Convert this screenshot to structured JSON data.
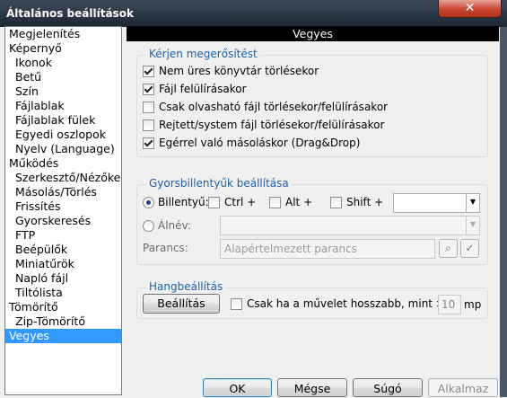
{
  "window": {
    "title": "Általános beállítások",
    "close_glyph": "✕"
  },
  "tree": {
    "items": [
      {
        "label": "Megjelenítés",
        "level": 0,
        "selected": false
      },
      {
        "label": "Képernyő",
        "level": 0,
        "selected": false
      },
      {
        "label": "Ikonok",
        "level": 1,
        "selected": false
      },
      {
        "label": "Betű",
        "level": 1,
        "selected": false
      },
      {
        "label": "Szín",
        "level": 1,
        "selected": false
      },
      {
        "label": "Fájlablak",
        "level": 1,
        "selected": false
      },
      {
        "label": "Fájlablak fülek",
        "level": 1,
        "selected": false
      },
      {
        "label": "Egyedi oszlopok",
        "level": 1,
        "selected": false
      },
      {
        "label": "Nyelv (Language)",
        "level": 1,
        "selected": false
      },
      {
        "label": "Működés",
        "level": 0,
        "selected": false
      },
      {
        "label": "Szerkesztő/Nézőke",
        "level": 1,
        "selected": false
      },
      {
        "label": "Másolás/Törlés",
        "level": 1,
        "selected": false
      },
      {
        "label": "Frissítés",
        "level": 1,
        "selected": false
      },
      {
        "label": "Gyorskeresés",
        "level": 1,
        "selected": false
      },
      {
        "label": "FTP",
        "level": 1,
        "selected": false
      },
      {
        "label": "Beépülők",
        "level": 1,
        "selected": false
      },
      {
        "label": "Miniatűrök",
        "level": 1,
        "selected": false
      },
      {
        "label": "Napló fájl",
        "level": 1,
        "selected": false
      },
      {
        "label": "Tiltólista",
        "level": 1,
        "selected": false
      },
      {
        "label": "Tömörítő",
        "level": 0,
        "selected": false
      },
      {
        "label": "Zip-Tömörítő",
        "level": 1,
        "selected": false
      },
      {
        "label": "Vegyes",
        "level": 0,
        "selected": true
      }
    ]
  },
  "panel": {
    "header": "Vegyes",
    "confirm_group": {
      "title": "Kérjen megerősítést",
      "options": [
        {
          "label": "Nem üres könyvtár törlésekor",
          "checked": true
        },
        {
          "label": "Fájl felülírásakor",
          "checked": true
        },
        {
          "label": "Csak olvasható fájl törlésekor/felülírásakor",
          "checked": false
        },
        {
          "label": "Rejtett/system fájl törlésekor/felülírásakor",
          "checked": false
        },
        {
          "label": "Egérrel való másoláskor (Drag&Drop)",
          "checked": true
        }
      ]
    },
    "hotkey_group": {
      "title": "Gyorsbillentyűk beállítása",
      "radio_key_label": "Billentyű:",
      "ctrl_label": "Ctrl +",
      "alt_label": "Alt +",
      "shift_label": "Shift +",
      "key_combo_value": "",
      "radio_alias_label": "Álnév:",
      "alias_value": "",
      "command_label": "Parancs:",
      "command_placeholder": "Alapértelmezett parancs",
      "combo_arrow_glyph": "▼",
      "search_glyph": "⌕",
      "check_glyph": "✓"
    },
    "sound_group": {
      "title": "Hangbeállítás",
      "settings_button": "Beállítás",
      "only_if_label": "Csak ha a művelet hosszabb, mint >",
      "threshold_value": "10",
      "unit_label": "mp"
    }
  },
  "buttons": {
    "ok": "OK",
    "cancel": "Mégse",
    "help": "Súgó",
    "apply": "Alkalmaz"
  }
}
